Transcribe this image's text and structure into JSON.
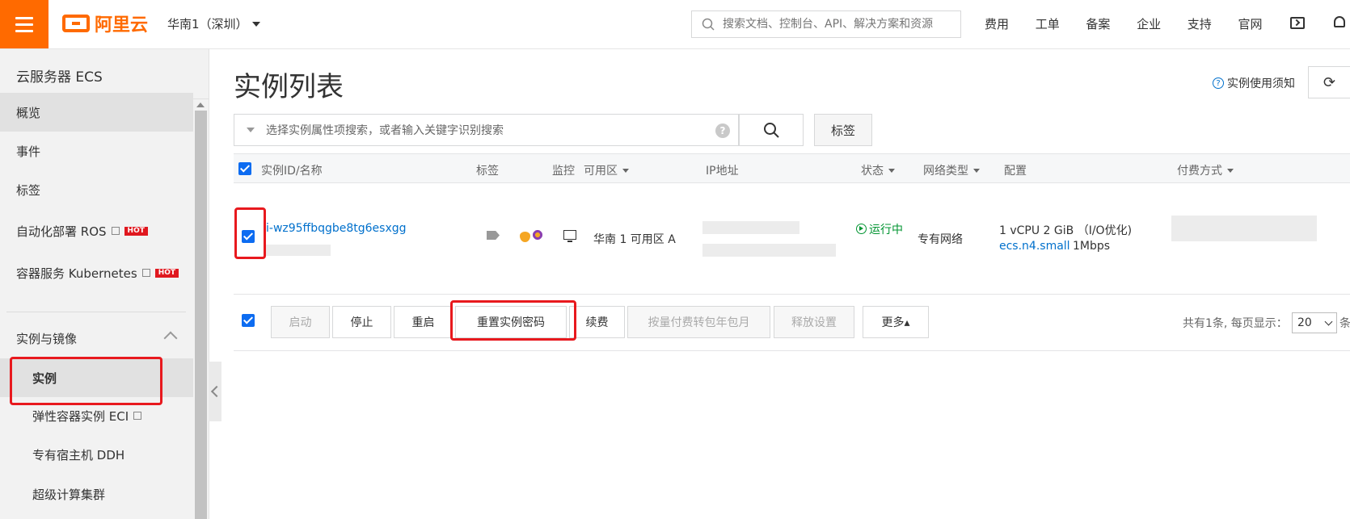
{
  "topbar": {
    "logo_text": "阿里云",
    "region": "华南1（深圳）",
    "search_placeholder": "搜索文档、控制台、API、解决方案和资源",
    "nav": [
      "费用",
      "工单",
      "备案",
      "企业",
      "支持",
      "官网"
    ],
    "brand_color": "#ff6a00"
  },
  "sidebar": {
    "title": "云服务器 ECS",
    "items": [
      {
        "label": "概览"
      },
      {
        "label": "事件"
      },
      {
        "label": "标签"
      },
      {
        "label": "自动化部署 ROS",
        "badge": "HOT"
      },
      {
        "label": "容器服务 Kubernetes",
        "badge": "HOT"
      }
    ],
    "group": "实例与镜像",
    "sub_items": [
      {
        "label": "实例"
      },
      {
        "label": "弹性容器实例 ECI"
      },
      {
        "label": "专有宿主机 DDH"
      },
      {
        "label": "超级计算集群"
      }
    ]
  },
  "main": {
    "title": "实例列表",
    "help_link": "实例使用须知",
    "filter_placeholder": "选择实例属性项搜索，或者输入关键字识别搜索",
    "tag_button": "标签",
    "columns": [
      "实例ID/名称",
      "标签",
      "监控",
      "可用区",
      "IP地址",
      "状态",
      "网络类型",
      "配置",
      "付费方式"
    ],
    "rows": [
      {
        "instance_id": "i-wz95ffbqgbe8tg6esxgg",
        "zone": "华南 1 可用区 A",
        "status": "运行中",
        "network": "专有网络",
        "config_line1": "1 vCPU 2 GiB （I/O优化)",
        "config_type": "ecs.n4.small",
        "bandwidth": "1Mbps"
      }
    ],
    "actions": [
      "启动",
      "停止",
      "重启",
      "重置实例密码",
      "续费",
      "按量付费转包年包月",
      "释放设置",
      "更多▴"
    ],
    "pager_text": "共有1条, 每页显示：",
    "page_size": "20",
    "pager_tail": "条"
  }
}
